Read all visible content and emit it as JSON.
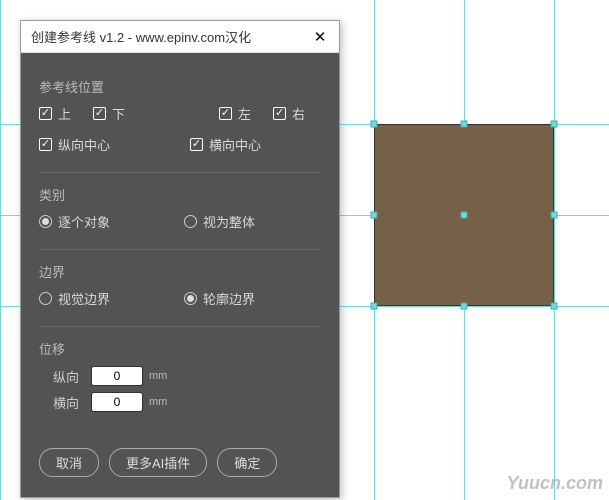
{
  "dialog": {
    "title": "创建参考线 v1.2 - www.epinv.com汉化",
    "position_group": {
      "label": "参考线位置",
      "top": "上",
      "bottom": "下",
      "left": "左",
      "right": "右",
      "v_center": "纵向中心",
      "h_center": "横向中心",
      "checked": {
        "top": true,
        "bottom": true,
        "left": true,
        "right": true,
        "v_center": true,
        "h_center": true
      }
    },
    "category_group": {
      "label": "类别",
      "per_object": "逐个对象",
      "as_whole": "视为整体",
      "selected": "per_object"
    },
    "bounds_group": {
      "label": "边界",
      "visual": "视觉边界",
      "outline": "轮廓边界",
      "selected": "outline"
    },
    "offset_group": {
      "label": "位移",
      "v_label": "纵向",
      "h_label": "横向",
      "v_value": "0",
      "h_value": "0",
      "unit": "mm"
    },
    "buttons": {
      "cancel": "取消",
      "more": "更多AI插件",
      "ok": "确定"
    }
  },
  "watermark": "Yuucn.com"
}
